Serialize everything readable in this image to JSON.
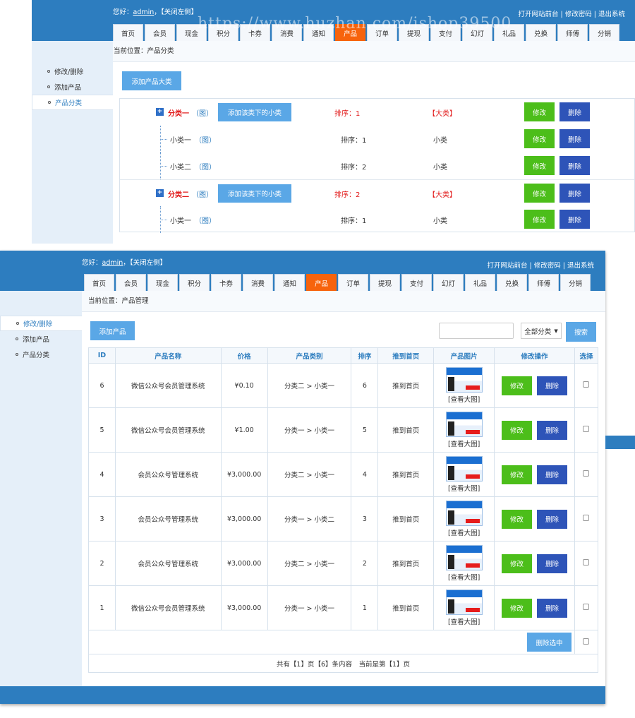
{
  "header": {
    "greeting_prefix": "您好：",
    "user": "admin",
    "greeting_sep": "，",
    "close_left": "【关闭左侧】",
    "link_front": "打开网站前台",
    "link_pwd": "修改密码",
    "link_exit": "退出系统",
    "sep": " | "
  },
  "watermark": "https://www.huzhan.com/ishop39500",
  "nav": [
    "首页",
    "会员",
    "现金",
    "积分",
    "卡券",
    "消费",
    "通知",
    "产品",
    "订单",
    "提现",
    "支付",
    "幻灯",
    "礼品",
    "兑换",
    "师傅",
    "分销"
  ],
  "nav_active": "产品",
  "sidebar": [
    "修改/删除",
    "添加产品",
    "产品分类"
  ],
  "win1": {
    "crumb": "当前位置：产品分类",
    "add_big": "添加产品大类",
    "add_sub": "添加该类下的小类",
    "edit": "修改",
    "del": "删除",
    "rows": [
      {
        "name": "分类一",
        "img": "（图）",
        "sort": "排序：1",
        "type": "【大类】",
        "big": true
      },
      {
        "name": "小类一",
        "img": "（图）",
        "sort": "排序：1",
        "type": "小类",
        "big": false
      },
      {
        "name": "小类二",
        "img": "（图）",
        "sort": "排序：2",
        "type": "小类",
        "big": false
      },
      {
        "name": "分类二",
        "img": "（图）",
        "sort": "排序：2",
        "type": "【大类】",
        "big": true
      },
      {
        "name": "小类一",
        "img": "（图）",
        "sort": "排序：1",
        "type": "小类",
        "big": false
      }
    ]
  },
  "win2": {
    "crumb": "当前位置：产品管理",
    "add_product": "添加产品",
    "search_value": "",
    "category_select": "全部分类",
    "search_btn": "搜索",
    "headers": [
      "ID",
      "产品名称",
      "价格",
      "产品类别",
      "排序",
      "推到首页",
      "产品图片",
      "修改操作",
      "选择"
    ],
    "rows": [
      {
        "id": "6",
        "name": "微信公众号会员管理系统",
        "price": "¥0.10",
        "cat": "分类二 > 小类一",
        "sort": "6",
        "home": "推到首页"
      },
      {
        "id": "5",
        "name": "微信公众号会员管理系统",
        "price": "¥1.00",
        "cat": "分类一 > 小类一",
        "sort": "5",
        "home": "推到首页"
      },
      {
        "id": "4",
        "name": "会员公众号管理系统",
        "price": "¥3,000.00",
        "cat": "分类二 > 小类一",
        "sort": "4",
        "home": "推到首页"
      },
      {
        "id": "3",
        "name": "会员公众号管理系统",
        "price": "¥3,000.00",
        "cat": "分类一 > 小类二",
        "sort": "3",
        "home": "推到首页"
      },
      {
        "id": "2",
        "name": "会员公众号管理系统",
        "price": "¥3,000.00",
        "cat": "分类二 > 小类一",
        "sort": "2",
        "home": "推到首页"
      },
      {
        "id": "1",
        "name": "微信公众号会员管理系统",
        "price": "¥3,000.00",
        "cat": "分类一 > 小类一",
        "sort": "1",
        "home": "推到首页"
      }
    ],
    "view_big": "[查看大图]",
    "edit": "修改",
    "del": "删除",
    "delete_selected": "删除选中",
    "pager": "共有【1】页【6】条内容　当前是第【1】页"
  },
  "colors": {
    "brand": "#2d7dbf",
    "active_tab": "#f7630c",
    "edit": "#4cbe1a",
    "delete": "#2e54b8",
    "button": "#5aa7e6"
  }
}
